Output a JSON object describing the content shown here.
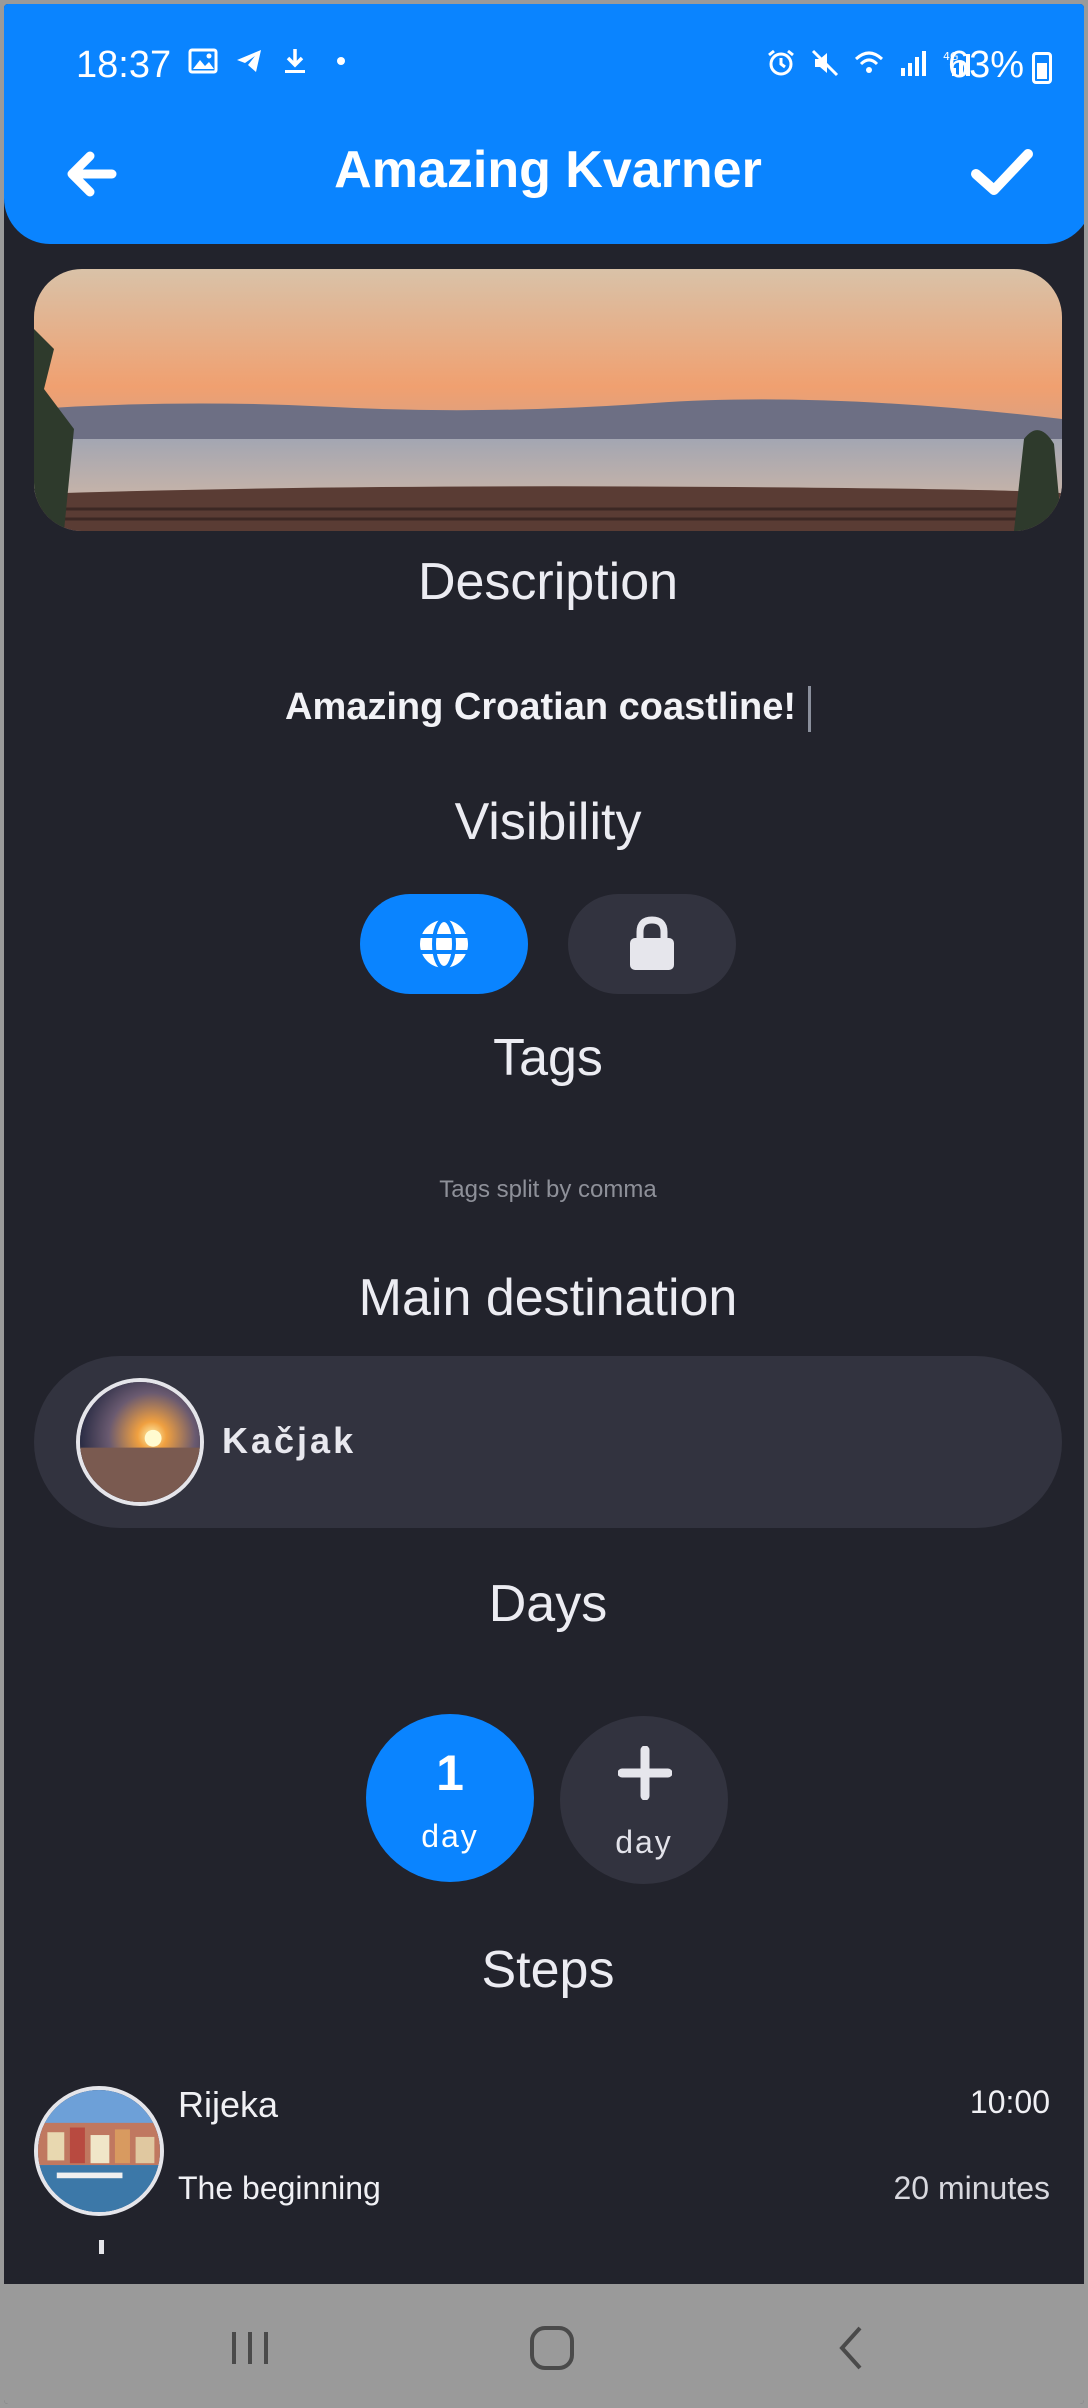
{
  "status_bar": {
    "time": "18:37",
    "battery": "63%",
    "left_icons": [
      "image-icon",
      "telegram-icon",
      "download-icon",
      "dot-icon"
    ],
    "right_icons": [
      "alarm-icon",
      "mute-icon",
      "wifi-icon",
      "signal-icon",
      "4g-signal-icon"
    ]
  },
  "header": {
    "title": "Amazing Kvarner",
    "back_icon": "arrow-left-icon",
    "save_icon": "check-icon",
    "color": "#0a84ff"
  },
  "description": {
    "heading": "Description",
    "value": "Amazing Croatian coastline!"
  },
  "visibility": {
    "heading": "Visibility",
    "options": [
      {
        "icon": "globe-icon",
        "selected": true
      },
      {
        "icon": "lock-icon",
        "selected": false
      }
    ]
  },
  "tags": {
    "heading": "Tags",
    "placeholder": "Tags split by comma"
  },
  "main_destination": {
    "heading": "Main destination",
    "name": "Kačjak"
  },
  "days": {
    "heading": "Days",
    "items": [
      {
        "number": "1",
        "label": "day",
        "selected": true
      }
    ],
    "add_label": "day"
  },
  "steps": {
    "heading": "Steps",
    "items": [
      {
        "name": "Rijeka",
        "time": "10:00",
        "note": "The beginning",
        "duration": "20 minutes"
      }
    ]
  },
  "nav_bar": {
    "buttons": [
      "recent-apps-icon",
      "home-icon",
      "back-icon"
    ]
  }
}
